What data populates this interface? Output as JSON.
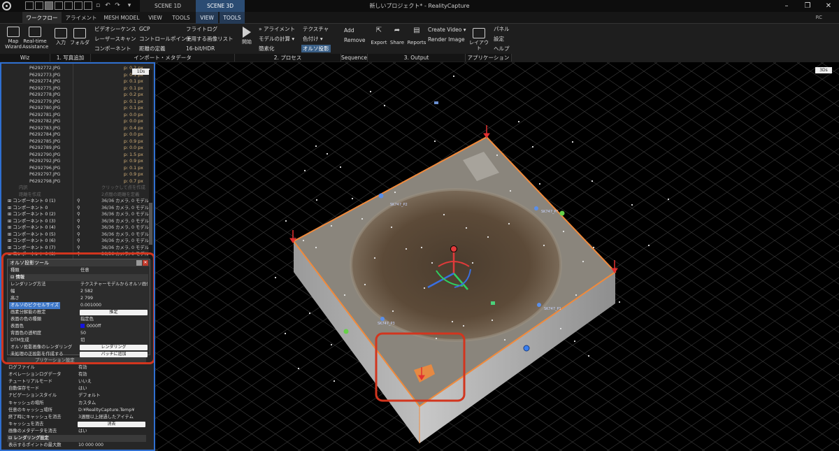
{
  "titlebar": {
    "scene_tabs": [
      "SCENE 1D",
      "SCENE 3D"
    ],
    "window_title": "新しいプロジェクト* - RealityCapture"
  },
  "ribbon_tabs": [
    "ワークフロー",
    "アライメント",
    "MESH MODEL",
    "VIEW",
    "TOOLS",
    "VIEW",
    "TOOLS"
  ],
  "ribbon_rc": "RC",
  "ribbon": {
    "wiz": {
      "map_wizard": "Map Wizard",
      "realtime": "Real-time Assistance",
      "label": "Wiz"
    },
    "add": {
      "input": "入力",
      "folder": "フォルダ",
      "label": "1. 写真追加"
    },
    "import": {
      "col1": [
        "ビデオシーケンス",
        "レーザースキャン",
        "コンポーネント"
      ],
      "col2": [
        "GCP",
        "コントロールポイント",
        "距離の定義"
      ],
      "col3": [
        "フライトログ",
        "使用する画像リスト",
        "16-bit/HDR"
      ],
      "label": "インポート・メタデータ"
    },
    "process": {
      "start": "開始",
      "col1": [
        "» アライメント",
        "モデルの計算 ▾",
        "簡素化"
      ],
      "col2": [
        "テクスチャ",
        "色付け ▾",
        "オルソ投影"
      ],
      "label": "2. プロセス"
    },
    "sequence": {
      "add": "Add",
      "remove": "Remove",
      "label": "Sequence"
    },
    "output": {
      "export": "Export",
      "share": "Share",
      "reports": "Reports",
      "create_video": "Create Video ▾",
      "render_image": "Render Image",
      "label": "3. Output"
    },
    "app": {
      "layout": "レイアウト",
      "panel": "パネル",
      "settings": "設定",
      "help": "ヘルプ",
      "label": "アプリケーション"
    }
  },
  "images": [
    {
      "name": "P6292772.JPG",
      "px": "p: 0.2 px"
    },
    {
      "name": "P6292773.JPG",
      "px": "p: 0.1 px"
    },
    {
      "name": "P6292774.JPG",
      "px": "p: 0.1 px"
    },
    {
      "name": "P6292775.JPG",
      "px": "p: 0.1 px"
    },
    {
      "name": "P6292778.JPG",
      "px": "p: 0.2 px"
    },
    {
      "name": "P6292779.JPG",
      "px": "p: 0.1 px"
    },
    {
      "name": "P6292780.JPG",
      "px": "p: 0.1 px"
    },
    {
      "name": "P6292781.JPG",
      "px": "p: 0.0 px"
    },
    {
      "name": "P6292782.JPG",
      "px": "p: 0.0 px"
    },
    {
      "name": "P6292783.JPG",
      "px": "p: 0.4 px"
    },
    {
      "name": "P6292784.JPG",
      "px": "p: 0.0 px"
    },
    {
      "name": "P6292785.JPG",
      "px": "p: 0.9 px"
    },
    {
      "name": "P6292789.JPG",
      "px": "p: 0.0 px"
    },
    {
      "name": "P6292790.JPG",
      "px": "p: 1.5 px"
    },
    {
      "name": "P6292792.JPG",
      "px": "p: 0.9 px"
    },
    {
      "name": "P6292796.JPG",
      "px": "p: 0.1 px"
    },
    {
      "name": "P6292797.JPG",
      "px": "p: 0.9 px"
    },
    {
      "name": "P6292798.JPG",
      "px": "p: 0.7 px"
    }
  ],
  "images_ids_button": "1Ds",
  "dim_rows": [
    {
      "name": "内訳",
      "value": "クリックして点を作成"
    },
    {
      "name": "距離を作成",
      "value": "2点間の距離を定義"
    }
  ],
  "components": [
    {
      "name": "コンポーネント 0 (1)",
      "value": "36/36 カメラ, 0 モデル"
    },
    {
      "name": "コンポーネント 0",
      "value": "36/36 カメラ, 0 モデル"
    },
    {
      "name": "コンポーネント 0 (2)",
      "value": "36/36 カメラ, 0 モデル"
    },
    {
      "name": "コンポーネント 0 (3)",
      "value": "36/36 カメラ, 0 モデル"
    },
    {
      "name": "コンポーネント 0 (4)",
      "value": "36/36 カメラ, 0 モデル"
    },
    {
      "name": "コンポーネント 0 (5)",
      "value": "36/36 カメラ, 0 モデル"
    },
    {
      "name": "コンポーネント 0 (6)",
      "value": "36/36 カメラ, 0 モデル"
    },
    {
      "name": "コンポーネント 0 (7)",
      "value": "36/36 カメラ, 0 モデル"
    },
    {
      "name": "コンポーネント 0 (8)",
      "value": "36/36 カメラ, 0 モデル"
    }
  ],
  "ortho_tool": {
    "title": "オルソ投影ツール",
    "rows": [
      {
        "k": "種類",
        "v": "任意"
      },
      {
        "k": "情報",
        "v": "",
        "head": true
      },
      {
        "k": "レンダリング方法",
        "v": "テクスチャーモデルからオルソ画像を..."
      },
      {
        "k": "幅",
        "v": "2 582"
      },
      {
        "k": "高さ",
        "v": "2 799"
      },
      {
        "k": "オルソのピクセルサイズ",
        "v": "0.001000",
        "sel": true
      },
      {
        "k": "画素分解能の推定",
        "v": "推定",
        "button": true
      },
      {
        "k": "表面の色の種類",
        "v": "指定色"
      },
      {
        "k": "表面色",
        "v": "0000ff",
        "swatch": true
      },
      {
        "k": "背面色の透明度",
        "v": "50"
      },
      {
        "k": "DTM生成",
        "v": "切"
      },
      {
        "k": "オルソ投影画像のレンダリング",
        "v": "レンダリング",
        "button": true
      },
      {
        "k": "未処理の正投影を作成する",
        "v": "バッチに追加",
        "button": true
      }
    ],
    "swatch_color": "#1515e0"
  },
  "settings": {
    "partial_header": "プリケーション設定",
    "rows": [
      {
        "k": "ログファイル",
        "v": "有効"
      },
      {
        "k": "オペレーションログデータ",
        "v": "有効"
      },
      {
        "k": "チュートリアルモード",
        "v": "いいえ"
      },
      {
        "k": "自動保存モード",
        "v": "はい"
      },
      {
        "k": "ナビゲーションスタイル",
        "v": "デフォルト"
      },
      {
        "k": "キャッシュの場所",
        "v": "カスタム"
      },
      {
        "k": "任意のキャッシュ場所",
        "v": "D:¥RealityCapture.Temp¥"
      },
      {
        "k": "終了時にキャッシュを消去",
        "v": "3週間以上経過したアイテム"
      },
      {
        "k": "キャッシュを消去",
        "v": "消去",
        "button": true
      },
      {
        "k": "画像のメタデータを消去",
        "v": "はい"
      },
      {
        "k": "レンダリング設定",
        "v": "",
        "head": true
      },
      {
        "k": "表示するポイントの最大数",
        "v": "10 000 000"
      }
    ]
  },
  "viewport": {
    "tag": "3Ds",
    "labels": [
      "SK747_P2",
      "SK747_P?",
      "SK747_P1",
      "SK747_P3"
    ]
  },
  "colors": {
    "accent_blue": "#2f6fd0",
    "highlight_red": "#d2351e",
    "ortho_box": "#f08a3c"
  }
}
